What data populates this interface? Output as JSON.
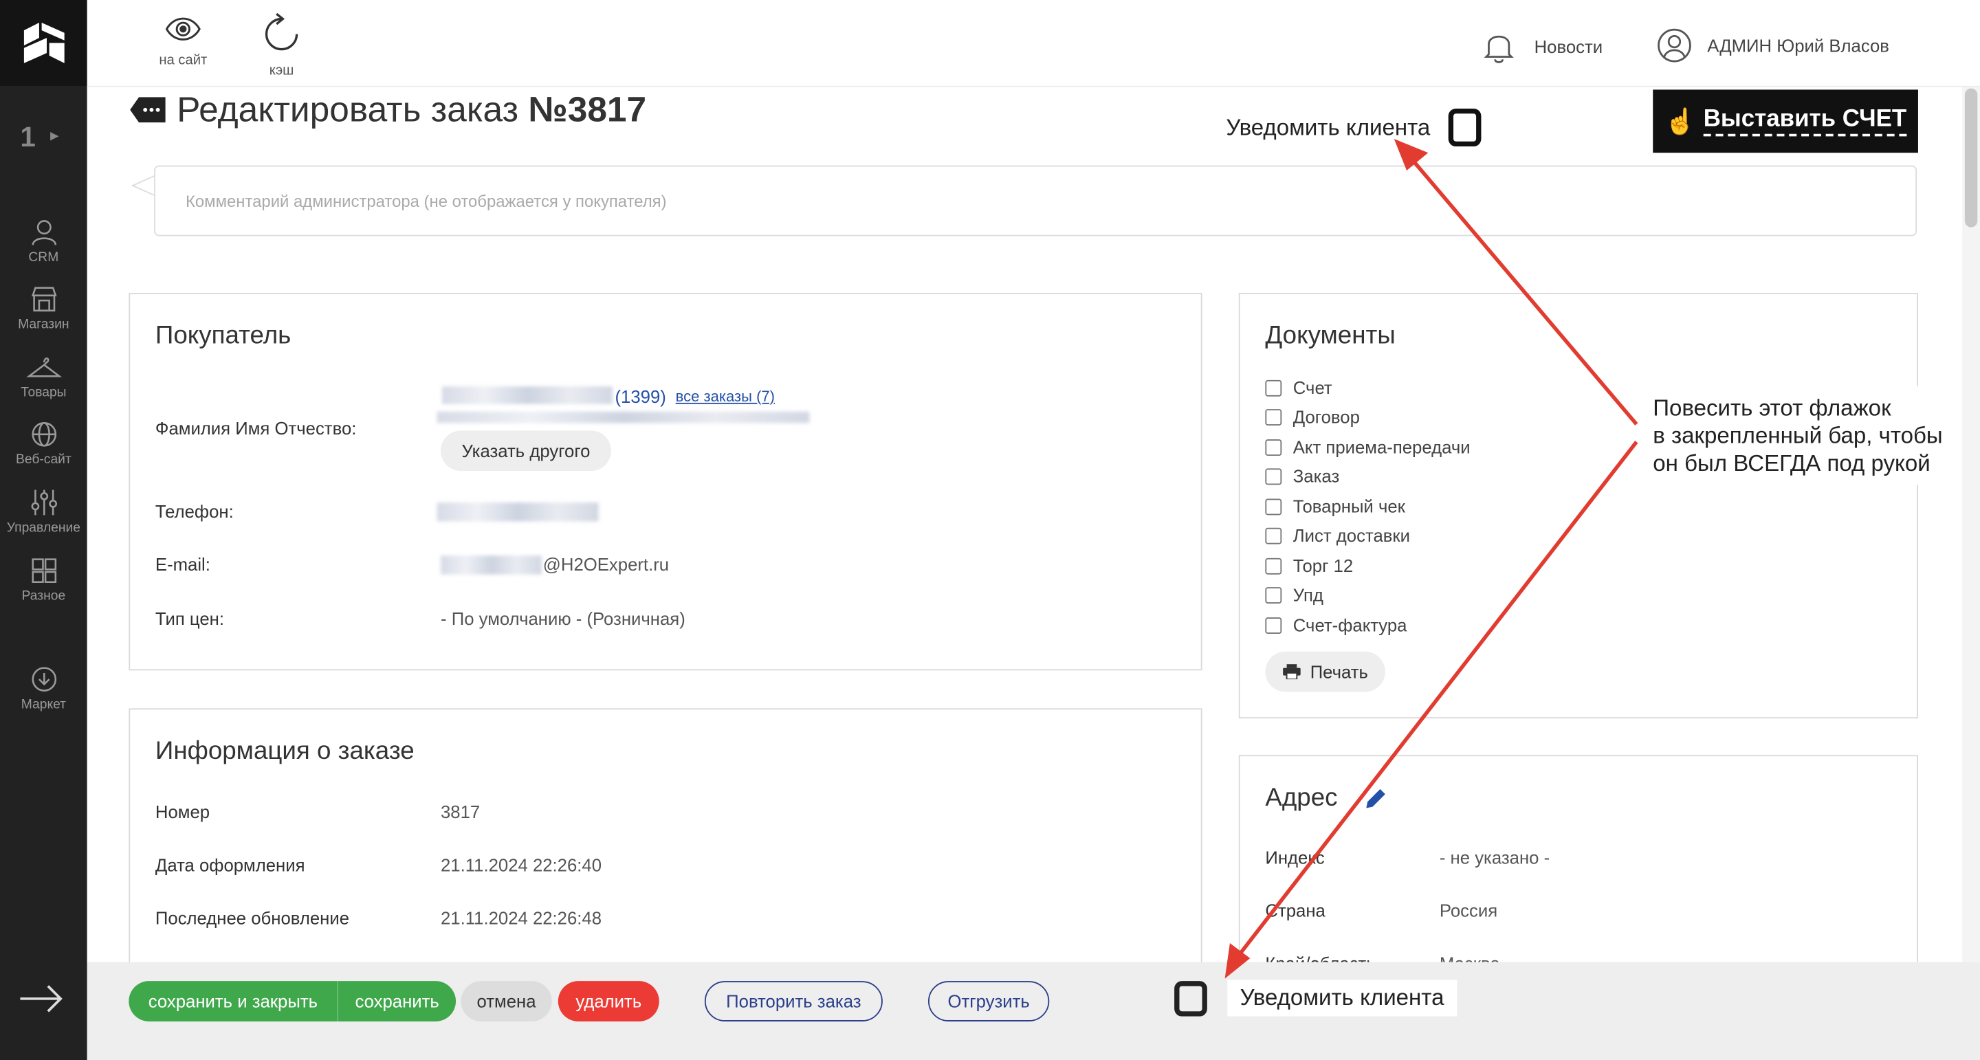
{
  "sidebar": {
    "page_number": "1",
    "items": [
      {
        "label": "CRM",
        "icon": "user-icon"
      },
      {
        "label": "Магазин",
        "icon": "store-icon"
      },
      {
        "label": "Товары",
        "icon": "hanger-icon"
      },
      {
        "label": "Веб-сайт",
        "icon": "globe-icon"
      },
      {
        "label": "Управление",
        "icon": "sliders-icon"
      },
      {
        "label": "Разное",
        "icon": "grid-icon"
      },
      {
        "label": "Маркет",
        "icon": "download-icon"
      }
    ]
  },
  "topbar": {
    "view_site": "на сайт",
    "cache": "кэш",
    "news": "Новости",
    "user": "АДМИН Юрий Власов"
  },
  "page": {
    "title_prefix": "Редактировать заказ ",
    "title_number": "№3817",
    "notify_label": "Уведомить клиента",
    "invoice_icon": "☝",
    "invoice_label": "Выставить СЧЕТ",
    "comment_placeholder": "Комментарий администратора (не отображается у покупателя)"
  },
  "buyer": {
    "title": "Покупатель",
    "fio_label": "Фамилия Имя Отчество:",
    "orders_count": "(1399)",
    "all_orders": "все заказы (7)",
    "choose_other": "Указать другого",
    "phone_label": "Телефон:",
    "email_label": "E-mail:",
    "email_domain": "@H2OExpert.ru",
    "price_label": "Тип цен:",
    "price_value": "- По умолчанию - (Розничная)"
  },
  "order_info": {
    "title": "Информация о заказе",
    "rows": [
      {
        "label": "Номер",
        "value": "3817"
      },
      {
        "label": "Дата оформления",
        "value": "21.11.2024 22:26:40"
      },
      {
        "label": "Последнее обновление",
        "value": "21.11.2024 22:26:48"
      }
    ]
  },
  "documents": {
    "title": "Документы",
    "items": [
      "Счет",
      "Договор",
      "Акт приема-передачи",
      "Заказ",
      "Товарный чек",
      "Лист доставки",
      "Торг 12",
      "Упд",
      "Счет-фактура"
    ],
    "print": "Печать"
  },
  "address": {
    "title": "Адрес",
    "rows": [
      {
        "label": "Индекс",
        "value": "- не указано -"
      },
      {
        "label": "Страна",
        "value": "Россия"
      },
      {
        "label": "Край/область",
        "value": "Москва"
      }
    ]
  },
  "bottombar": {
    "save_close": "сохранить и закрыть",
    "save": "сохранить",
    "cancel": "отмена",
    "delete": "удалить",
    "repeat": "Повторить заказ",
    "ship": "Отгрузить",
    "notify_label": "Уведомить клиента"
  },
  "annotation": {
    "line1": "Повесить этот флажок",
    "line2": "в закрепленный бар, чтобы",
    "line3": "он был ВСЕГДА под рукой"
  },
  "colors": {
    "sidebar": "#222222",
    "green": "#3fa84b",
    "red": "#ec3b35",
    "link": "#2451a8",
    "arrow": "#e23b30"
  }
}
